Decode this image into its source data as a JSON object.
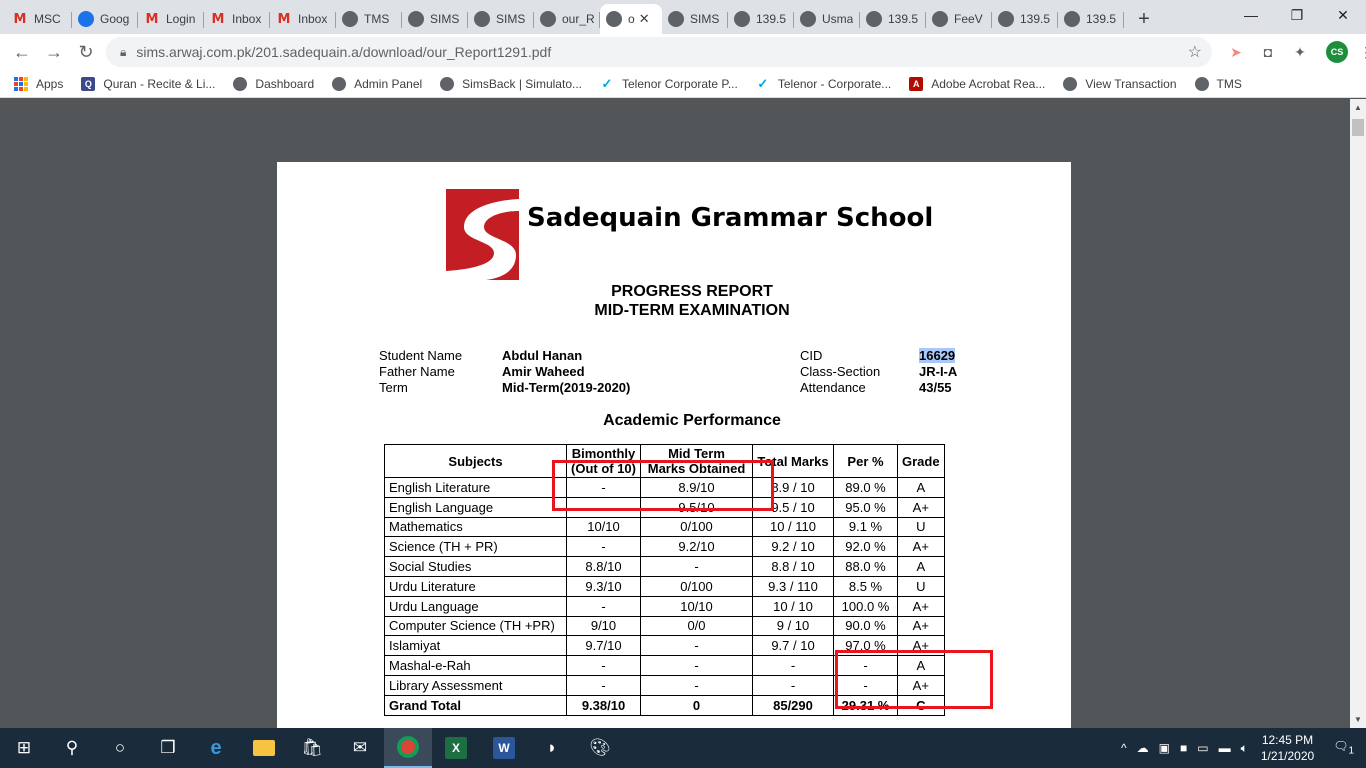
{
  "browser": {
    "tabs": [
      {
        "icon": "gmail",
        "label": "MSC"
      },
      {
        "icon": "google",
        "label": "Goog"
      },
      {
        "icon": "gmail",
        "label": "Login"
      },
      {
        "icon": "gmail",
        "label": "Inbox"
      },
      {
        "icon": "gmail",
        "label": "Inbox"
      },
      {
        "icon": "globe",
        "label": "TMS"
      },
      {
        "icon": "globe",
        "label": "SIMS"
      },
      {
        "icon": "globe",
        "label": "SIMS"
      },
      {
        "icon": "globe",
        "label": "our_R"
      },
      {
        "icon": "globe",
        "label": "o",
        "active": true
      },
      {
        "icon": "globe",
        "label": "SIMS"
      },
      {
        "icon": "globe",
        "label": "139.5"
      },
      {
        "icon": "globe",
        "label": "Usma"
      },
      {
        "icon": "globe",
        "label": "139.5"
      },
      {
        "icon": "globe",
        "label": "FeeV"
      },
      {
        "icon": "globe",
        "label": "139.5"
      },
      {
        "icon": "globe",
        "label": "139.5"
      }
    ],
    "url": "sims.arwaj.com.pk/201.sadequain.a/download/our_Report1291.pdf",
    "avatar_initials": "CS",
    "bookmarks": [
      {
        "icon": "apps",
        "label": "Apps"
      },
      {
        "icon": "quran",
        "label": "Quran - Recite & Li..."
      },
      {
        "icon": "globe",
        "label": "Dashboard"
      },
      {
        "icon": "globe",
        "label": "Admin Panel"
      },
      {
        "icon": "globe",
        "label": "SimsBack | Simulato..."
      },
      {
        "icon": "telenor",
        "label": "Telenor Corporate P..."
      },
      {
        "icon": "telenor",
        "label": "Telenor - Corporate..."
      },
      {
        "icon": "acrobat",
        "label": "Adobe Acrobat Rea..."
      },
      {
        "icon": "globe",
        "label": "View Transaction"
      },
      {
        "icon": "globe",
        "label": "TMS"
      }
    ]
  },
  "report": {
    "school_name": "Sadequain Grammar School",
    "title": "PROGRESS REPORT",
    "subtitle": "MID-TERM EXAMINATION",
    "labels": {
      "student_name": "Student Name",
      "father_name": "Father Name",
      "term": "Term",
      "cid": "CID",
      "class_section": "Class-Section",
      "attendance": "Attendance"
    },
    "values": {
      "student_name": "Abdul Hanan",
      "father_name": "Amir Waheed",
      "term": "Mid-Term(2019-2020)",
      "cid": "16629",
      "class_section": "JR-I-A",
      "attendance": "43/55"
    },
    "section_title": "Academic Performance",
    "table": {
      "headers": {
        "subjects": "Subjects",
        "bimonthly_1": "Bimonthly",
        "bimonthly_2": "(Out of 10)",
        "midterm_1": "Mid Term",
        "midterm_2": "Marks Obtained",
        "total": "Total Marks",
        "per": "Per %",
        "grade": "Grade"
      },
      "rows": [
        [
          "English Literature",
          "-",
          "8.9/10",
          "8.9 / 10",
          "89.0 %",
          "A"
        ],
        [
          "English Language",
          "-",
          "9.5/10",
          "9.5 / 10",
          "95.0 %",
          "A+"
        ],
        [
          "Mathematics",
          "10/10",
          "0/100",
          "10 / 110",
          "9.1 %",
          "U"
        ],
        [
          "Science (TH + PR)",
          "-",
          "9.2/10",
          "9.2 / 10",
          "92.0 %",
          "A+"
        ],
        [
          "Social Studies",
          "8.8/10",
          "-",
          "8.8 / 10",
          "88.0 %",
          "A"
        ],
        [
          "Urdu Literature",
          "9.3/10",
          "0/100",
          "9.3 / 110",
          "8.5 %",
          "U"
        ],
        [
          "Urdu Language",
          "-",
          "10/10",
          "10 / 10",
          "100.0 %",
          "A+"
        ],
        [
          "Computer Science (TH +PR)",
          "9/10",
          "0/0",
          "9 / 10",
          "90.0 %",
          "A+"
        ],
        [
          "Islamiyat",
          "9.7/10",
          "-",
          "9.7 / 10",
          "97.0 %",
          "A+"
        ],
        [
          "Mashal-e-Rah",
          "-",
          "-",
          "-",
          "-",
          "A"
        ],
        [
          "Library Assessment",
          "-",
          "-",
          "-",
          "-",
          "A+"
        ]
      ],
      "total_row": [
        "Grand Total",
        "9.38/10",
        "0",
        "85/290",
        "29.31 %",
        "C"
      ]
    }
  },
  "taskbar": {
    "time": "12:45 PM",
    "date": "1/21/2020",
    "notifications": "1"
  }
}
